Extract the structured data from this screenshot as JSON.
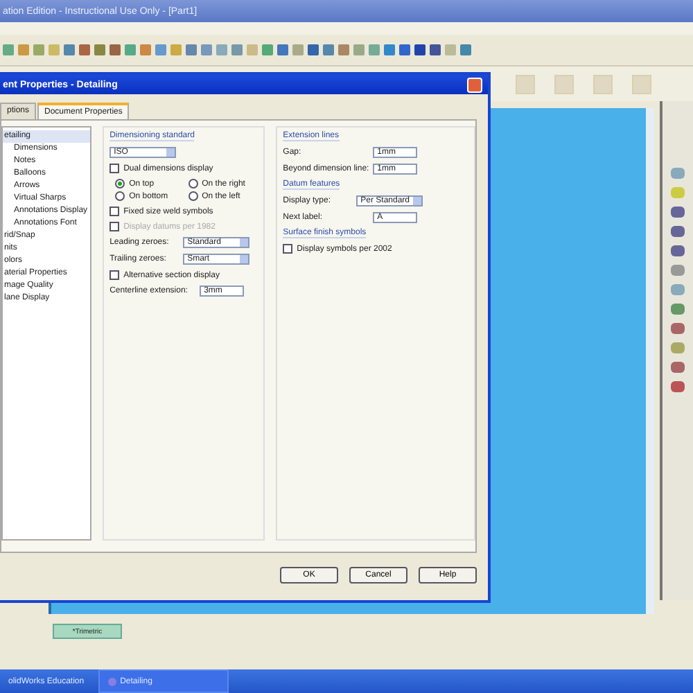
{
  "app_title": "ation Edition - Instructional Use Only - [Part1]",
  "dialog": {
    "title": "ent Properties - Detailing",
    "tabs": [
      {
        "label": "ptions",
        "selected": false
      },
      {
        "label": "Document Properties",
        "selected": true
      }
    ],
    "tree": [
      {
        "label": "etailing",
        "selected": true,
        "children": [
          {
            "label": "Dimensions",
            "selected": false
          },
          {
            "label": "Notes",
            "selected": false
          },
          {
            "label": "Balloons",
            "selected": false
          },
          {
            "label": "Arrows",
            "selected": false
          },
          {
            "label": "Virtual Sharps",
            "selected": false
          },
          {
            "label": "Annotations Display",
            "selected": false
          },
          {
            "label": "Annotations Font",
            "selected": false
          }
        ]
      },
      {
        "label": "rid/Snap",
        "selected": false
      },
      {
        "label": "nits",
        "selected": false
      },
      {
        "label": "olors",
        "selected": false
      },
      {
        "label": "aterial Properties",
        "selected": false
      },
      {
        "label": "mage Quality",
        "selected": false
      },
      {
        "label": "lane Display",
        "selected": false
      }
    ],
    "dimensioning": {
      "heading": "Dimensioning standard",
      "standard": "ISO",
      "dual": {
        "label": "Dual dimensions display",
        "checked": false
      },
      "radios": [
        {
          "label": "On top",
          "selected": true
        },
        {
          "label": "On the right",
          "selected": false
        },
        {
          "label": "On bottom",
          "selected": false
        },
        {
          "label": "On the left",
          "selected": false
        }
      ],
      "checks": [
        {
          "label": "Fixed size weld symbols",
          "checked": false,
          "disabled": false
        },
        {
          "label": "Display datums per 1982",
          "checked": false,
          "disabled": true
        }
      ],
      "selects": [
        {
          "label": "Leading zeroes:",
          "value": "Standard"
        },
        {
          "label": "Trailing zeroes:",
          "value": "Smart"
        }
      ],
      "alt": {
        "label": "Alternative section display",
        "checked": false
      },
      "centerline": {
        "label": "Centerline extension:",
        "value": "3mm"
      }
    },
    "extension": {
      "heading": "Extension lines",
      "fields": [
        {
          "label": "Gap:",
          "value": "1mm"
        },
        {
          "label": "Beyond dimension line:",
          "value": "1mm"
        }
      ]
    },
    "datum": {
      "heading": "Datum features",
      "display": {
        "label": "Display type:",
        "value": "Per Standard"
      },
      "next": {
        "label": "Next label:",
        "value": "A"
      }
    },
    "surface": {
      "heading": "Surface finish symbols",
      "check": {
        "label": "Display symbols per 2002",
        "checked": false
      }
    },
    "buttons": [
      "OK",
      "Cancel",
      "Help"
    ]
  },
  "viewport_tab": "*Trimetric",
  "taskbar": [
    {
      "label": "olidWorks Education",
      "selected": false
    },
    {
      "label": "Detailing",
      "selected": true
    }
  ]
}
